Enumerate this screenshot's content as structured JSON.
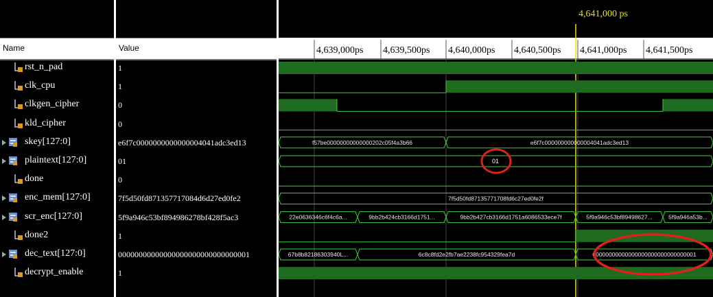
{
  "columns": {
    "name": "Name",
    "value": "Value"
  },
  "cursor": {
    "label": "4,641,000 ps"
  },
  "timeline": {
    "ticks": [
      "4,639,000ps",
      "4,639,500ps",
      "4,640,000ps",
      "4,640,500ps",
      "4,641,000ps",
      "4,641,500ps"
    ]
  },
  "signals": [
    {
      "name": "rst_n_pad",
      "value": "1",
      "kind": "bit"
    },
    {
      "name": "clk_cpu",
      "value": "1",
      "kind": "bit"
    },
    {
      "name": "clkgen_cipher",
      "value": "0",
      "kind": "bit"
    },
    {
      "name": "kld_cipher",
      "value": "0",
      "kind": "bit"
    },
    {
      "name": "skey[127:0]",
      "value": "e6f7c0000000000000004041adc3ed13",
      "kind": "bus"
    },
    {
      "name": "plaintext[127:0]",
      "value": "01",
      "kind": "bus"
    },
    {
      "name": "done",
      "value": "0",
      "kind": "bit"
    },
    {
      "name": "enc_mem[127:0]",
      "value": "7f5d50fd871357717084d6d27ed0fe2",
      "kind": "bus"
    },
    {
      "name": "scr_enc[127:0]",
      "value": "5f9a946c53bf894986278bf428f5ac3",
      "kind": "bus"
    },
    {
      "name": "done2",
      "value": "1",
      "kind": "bit"
    },
    {
      "name": "dec_text[127:0]",
      "value": "00000000000000000000000000000001",
      "kind": "bus"
    },
    {
      "name": "decrypt_enable",
      "value": "1",
      "kind": "bit"
    }
  ],
  "waves": {
    "skey": [
      "f57be00000000000000202c05f4a3b66",
      "e6f7c000000000000004041adc3ed13"
    ],
    "plaintext": [
      "01"
    ],
    "enc_mem": [
      "7f5d50fd87135771708fd6c27ed0fe2f"
    ],
    "scr_enc": [
      "22e0636346c6f4c6a...",
      "9bb2b424cb3166d1751...",
      "9bb2b427cb3166d1751a6086533ece7f",
      "5f9a946c53bf89498627...",
      "5f9a946a53b..."
    ],
    "dec_text": [
      "67b8b82186303940L...",
      "6c8c8fd2e2fb7ae2238fc954329fea7d",
      "00000000000000000000000000000001"
    ]
  },
  "colors": {
    "green": "#1f6b1f",
    "greenLine": "#3fcf3f",
    "cursor": "#e8e200",
    "annotation": "#e0201a"
  }
}
